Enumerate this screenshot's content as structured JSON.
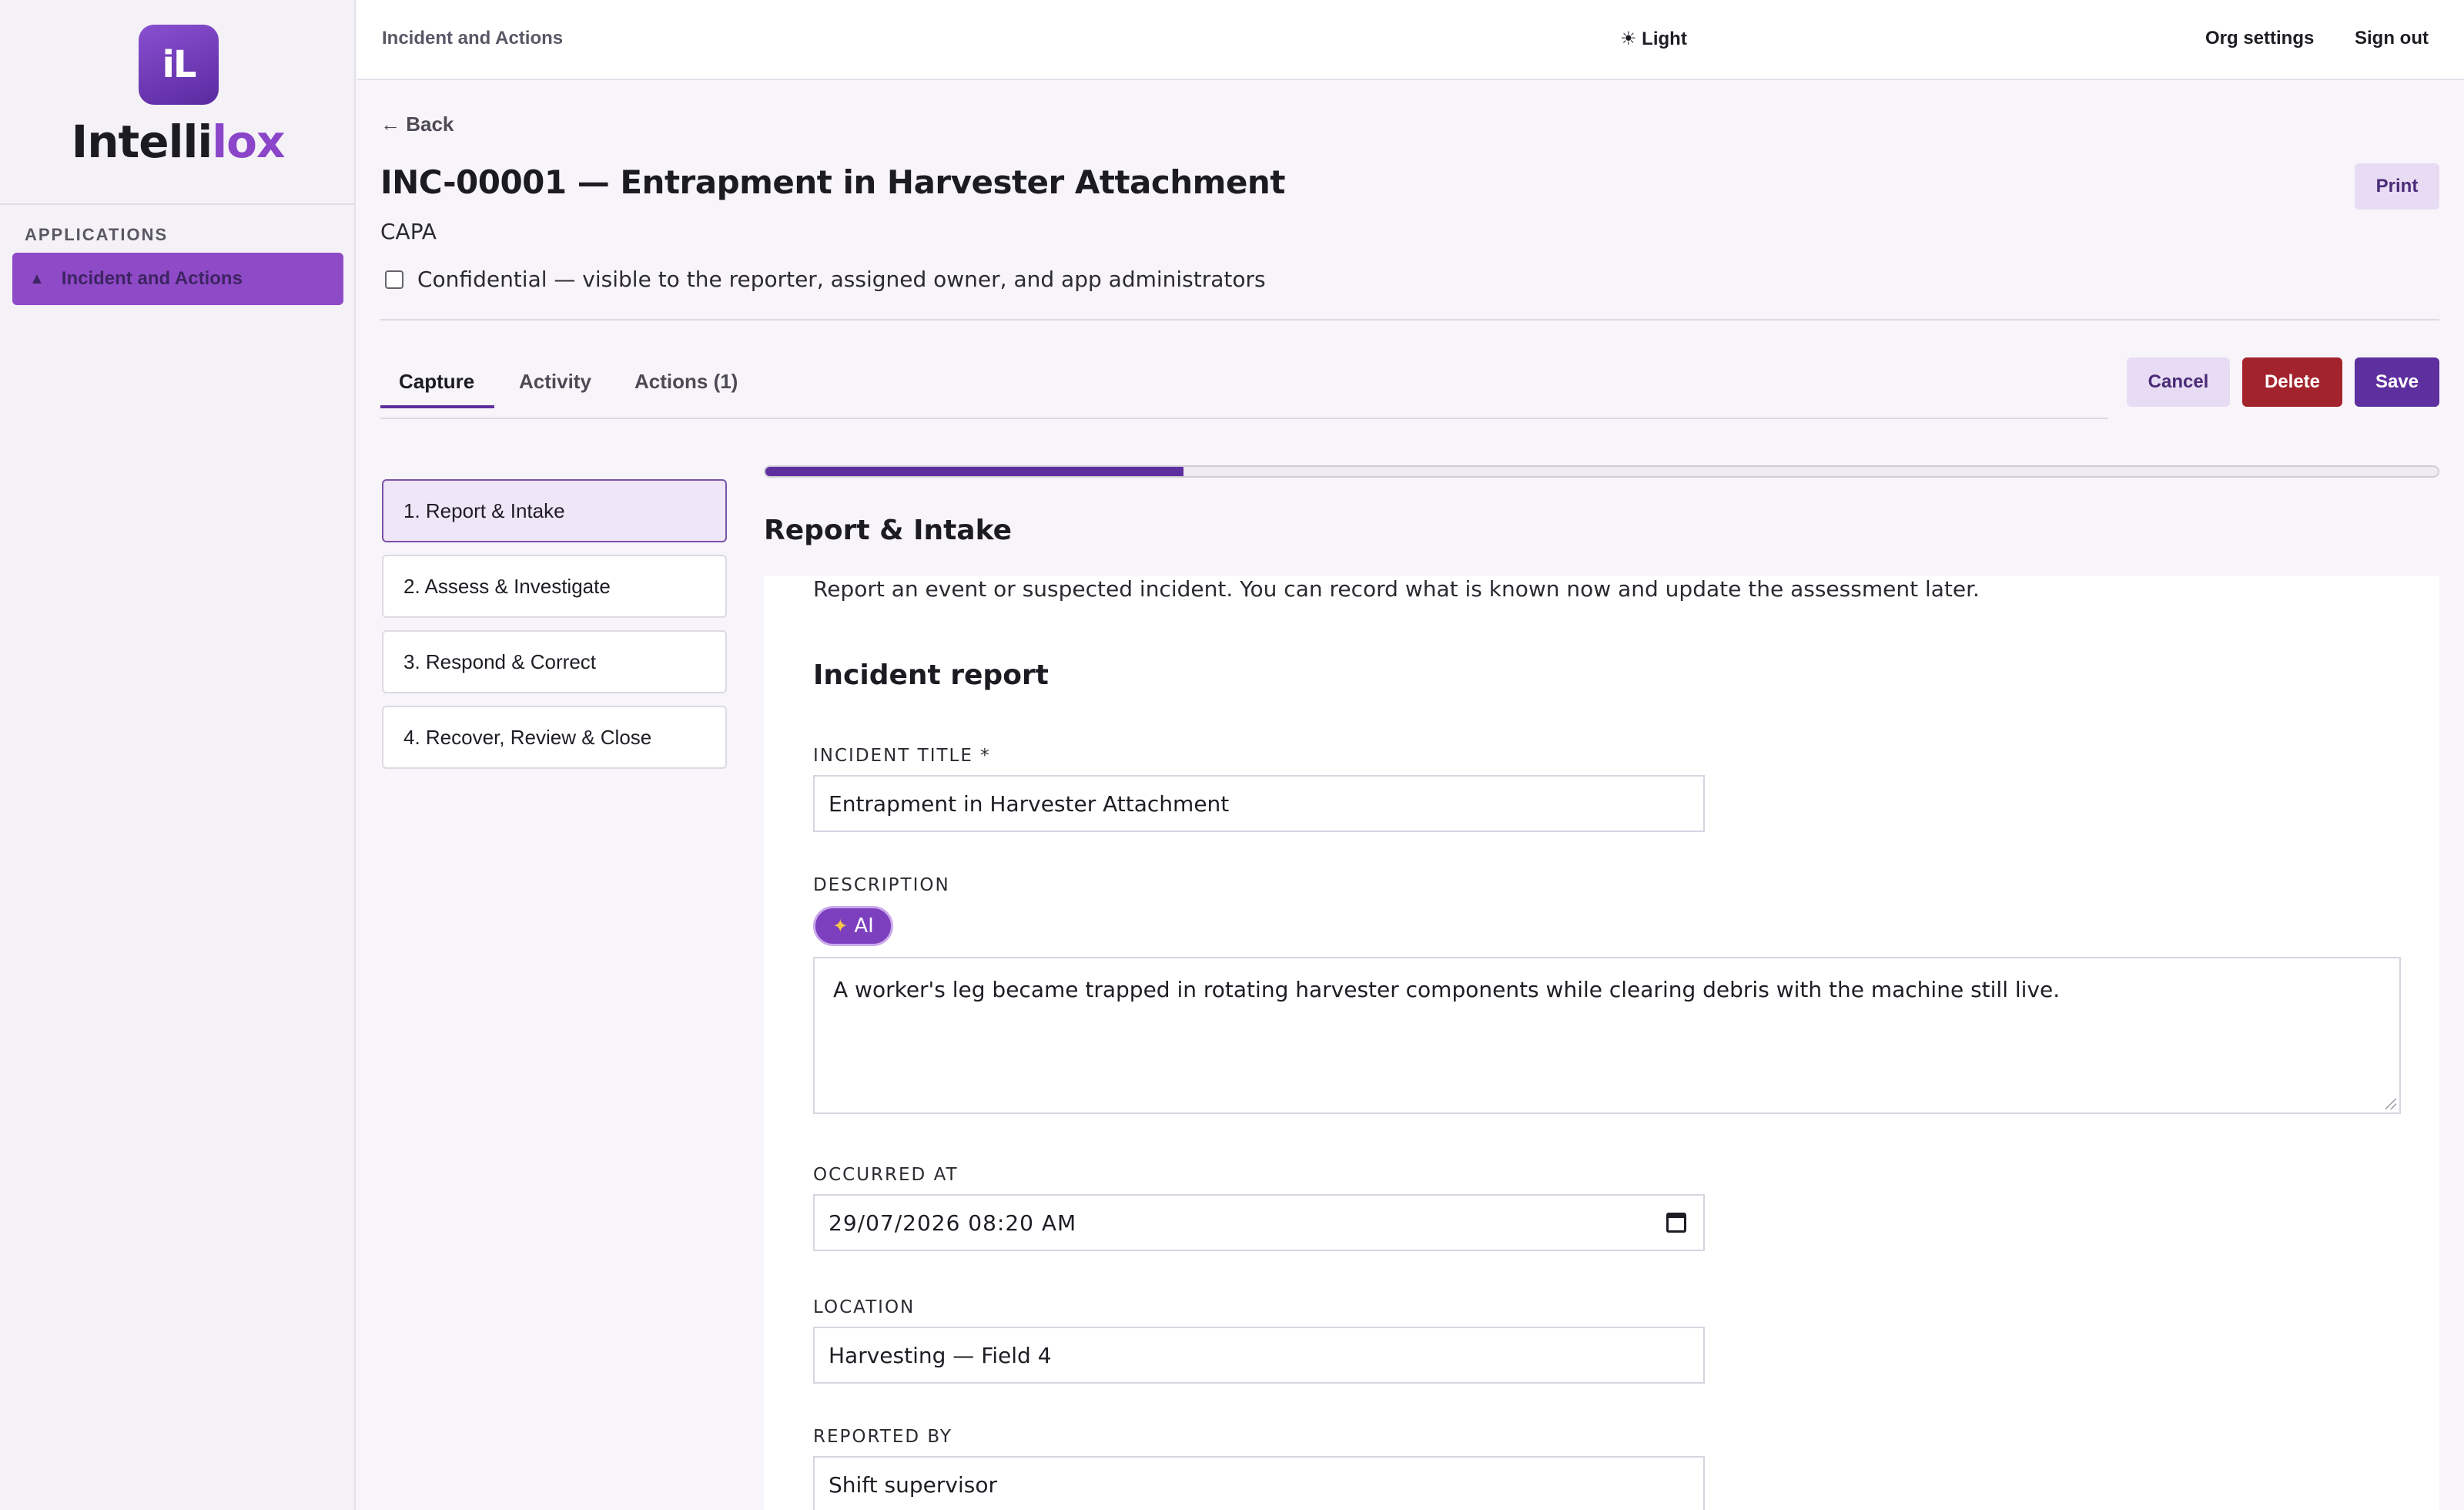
{
  "sidebar": {
    "logo_mark": "iL",
    "brand_main": "Intelli",
    "brand_accent": "lox",
    "section_heading": "APPLICATIONS",
    "items": [
      {
        "label": "Incident and Actions",
        "icon": "warning-icon",
        "active": true
      }
    ]
  },
  "topbar": {
    "app_title": "Incident and Actions",
    "theme_toggle": "☀ Light",
    "org_settings": "Org settings",
    "sign_out": "Sign out"
  },
  "header": {
    "back": "← Back",
    "title": "INC-00001 — Entrapment in Harvester Attachment",
    "subtitle": "CAPA",
    "confidential_label": "Confidential — visible to the reporter, assigned owner, and app administrators",
    "confidential_checked": false,
    "print": "Print"
  },
  "tabs": [
    {
      "label": "Capture",
      "active": true
    },
    {
      "label": "Activity",
      "active": false
    },
    {
      "label": "Actions (1)",
      "active": false
    }
  ],
  "actions": {
    "cancel": "Cancel",
    "delete": "Delete",
    "save": "Save"
  },
  "colors": {
    "accent": "#5e2f9e",
    "danger": "#a3232c",
    "brand": "#8a45c9"
  },
  "steps": [
    {
      "label": "1. Report & Intake",
      "active": true
    },
    {
      "label": "2. Assess & Investigate",
      "active": false
    },
    {
      "label": "3. Respond & Correct",
      "active": false
    },
    {
      "label": "4. Recover, Review & Close",
      "active": false
    }
  ],
  "progress": {
    "fraction": 0.25
  },
  "section": {
    "title": "Report & Intake",
    "intro": "Report an event or suspected incident. You can record what is known now and update the assessment later.",
    "card_heading": "Incident report"
  },
  "form": {
    "incident_title": {
      "label": "INCIDENT TITLE *",
      "value": "Entrapment in Harvester Attachment"
    },
    "description": {
      "label": "DESCRIPTION",
      "ai_button": "AI",
      "value": "A worker's leg became trapped in rotating harvester components while clearing debris with the machine still live."
    },
    "occurred_at": {
      "label": "OCCURRED AT",
      "value": "29/07/2026 08:20 AM"
    },
    "location": {
      "label": "LOCATION",
      "value": "Harvesting — Field 4"
    },
    "reported_by": {
      "label": "REPORTED BY",
      "value": "Shift supervisor"
    }
  }
}
